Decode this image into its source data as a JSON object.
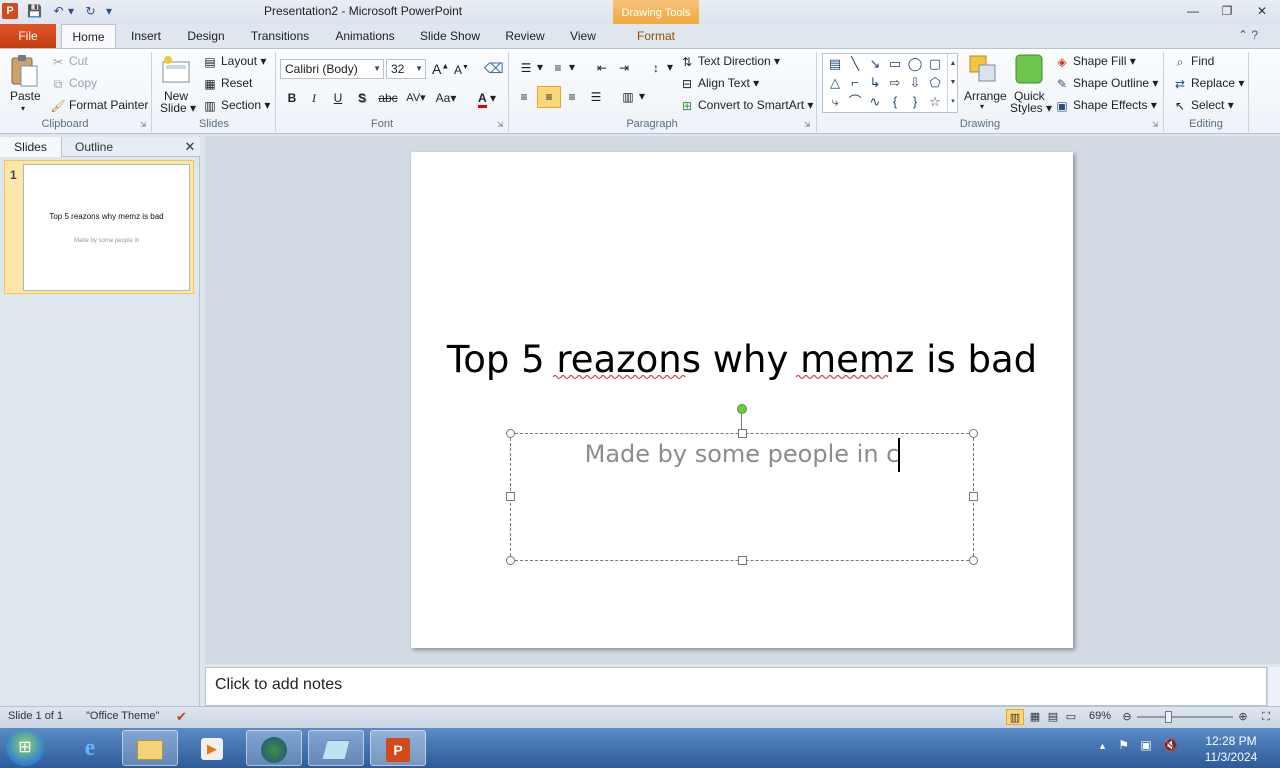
{
  "window": {
    "app_icon": "P",
    "title": "Presentation2  -  Microsoft PowerPoint",
    "contextual_tab": "Drawing Tools",
    "controls": [
      "—",
      "❐",
      "✕"
    ]
  },
  "qat": [
    "💾",
    "↶",
    "▾",
    "↻",
    "▾"
  ],
  "tabs": {
    "file": "File",
    "home": "Home",
    "insert": "Insert",
    "design": "Design",
    "transitions": "Transitions",
    "animations": "Animations",
    "slide_show": "Slide Show",
    "review": "Review",
    "view": "View",
    "format": "Format"
  },
  "help_icons": "⌃  ?",
  "clipboard": {
    "label": "Clipboard",
    "paste": "Paste",
    "cut": "Cut",
    "copy": "Copy",
    "format_painter": "Format Painter"
  },
  "slides_group": {
    "label": "Slides",
    "new_slide_line1": "New",
    "new_slide_line2": "Slide",
    "layout": "Layout",
    "reset": "Reset",
    "section": "Section"
  },
  "font": {
    "label": "Font",
    "family": "Calibri (Body)",
    "size": "32",
    "bold": "B",
    "italic": "I",
    "underline": "U",
    "shadow": "S",
    "strikethrough": "abc",
    "spacing": "AV",
    "case": "Aa",
    "color_letter": "A",
    "grow": "A",
    "shrink": "A"
  },
  "paragraph": {
    "label": "Paragraph",
    "text_direction": "Text Direction",
    "align_text": "Align Text",
    "smartart": "Convert to SmartArt"
  },
  "drawing": {
    "label": "Drawing",
    "arrange": "Arrange",
    "quick_styles_line1": "Quick",
    "quick_styles_line2": "Styles",
    "shape_fill": "Shape Fill",
    "shape_outline": "Shape Outline",
    "shape_effects": "Shape Effects",
    "shapes": [
      "▤",
      "╲",
      "↘",
      "▭",
      "◯",
      "▢",
      "△",
      "⌐",
      "↳",
      "⇨",
      "⇩",
      "⬠",
      "⤷",
      "⌒",
      "∿",
      "{",
      "}",
      "☆"
    ]
  },
  "editing": {
    "label": "Editing",
    "find": "Find",
    "replace": "Replace",
    "select": "Select"
  },
  "left_pane": {
    "tab_slides": "Slides",
    "tab_outline": "Outline",
    "close": "✕",
    "thumb_number": "1",
    "thumb_title": "Top 5 reazons why memz is bad",
    "thumb_subtitle": "Made by some people in"
  },
  "slide": {
    "title": "Top 5 reazons why memz is bad",
    "subtitle": "Made by some people in c"
  },
  "notes": {
    "placeholder": "Click to add notes"
  },
  "status": {
    "slide_count": "Slide 1 of 1",
    "theme": "\"Office Theme\"",
    "zoom": "69%"
  },
  "taskbar": {
    "time": "12:28 PM",
    "date": "11/3/2024"
  }
}
